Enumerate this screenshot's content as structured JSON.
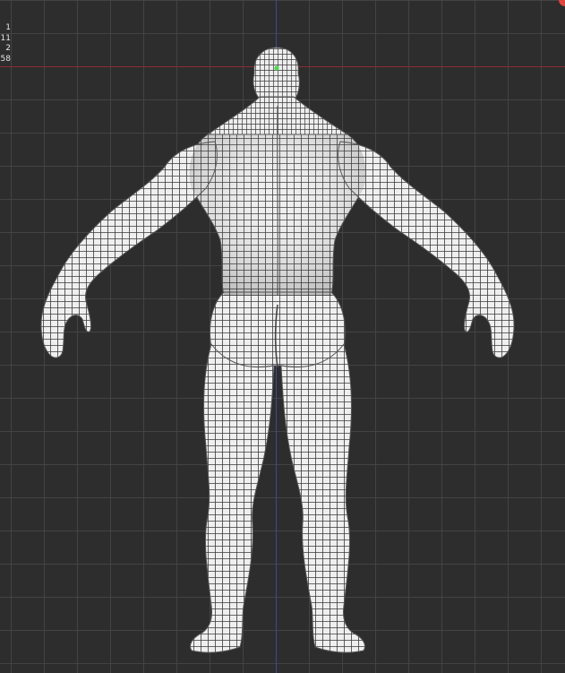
{
  "viewport": {
    "stats": [
      "1",
      "11",
      "2",
      "58"
    ],
    "colors": {
      "background": "#2d2d2d",
      "grid": "#464646",
      "x_axis": "#8a2d35",
      "y_axis": "#3b4fa8",
      "mesh_fill": "#efefef",
      "wire": "#3a3a3a",
      "pivot": "#4ddc4d",
      "corner_indicator": "#e0463e"
    },
    "icons": {
      "corner_indicator": "red-dot-icon",
      "pivot": "pivot-point-icon"
    },
    "model": "humanoid-base-mesh-back-view"
  }
}
